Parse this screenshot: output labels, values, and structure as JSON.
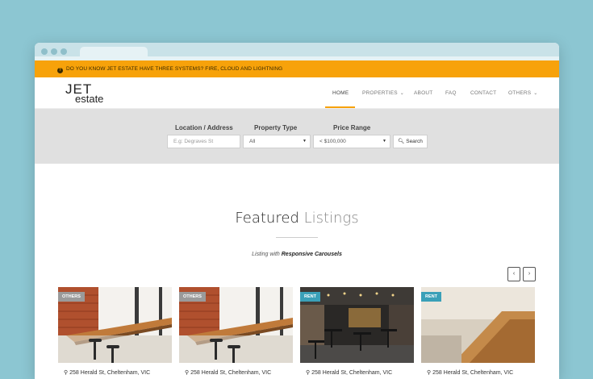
{
  "announcement": "DO YOU KNOW JET ESTATE HAVE THREE SYSTEMS? FIRE, CLOUD AND LIGHTNING",
  "logo": {
    "top": "JET",
    "bottom": "estate"
  },
  "nav": {
    "home": "HOME",
    "properties": "PROPERTIES",
    "about": "ABOUT",
    "faq": "FAQ",
    "contact": "CONTACT",
    "others": "OTHERS"
  },
  "search": {
    "location_label": "Location / Address",
    "location_placeholder": "E.g: Degraves St",
    "type_label": "Property Type",
    "type_value": "All",
    "price_label": "Price Range",
    "price_value": "< $100,000",
    "button_label": "Search"
  },
  "featured": {
    "title_bold": "Featured",
    "title_light": "Listings",
    "subtitle_prefix": "Listing with",
    "subtitle_emph": "Responsive Carousels"
  },
  "listings": [
    {
      "badge": "OTHERS",
      "address": "258 Herald St, Cheltenham, VIC"
    },
    {
      "badge": "OTHERS",
      "address": "258 Herald St, Cheltenham, VIC"
    },
    {
      "badge": "RENT",
      "address": "258 Herald St, Cheltenham, VIC"
    },
    {
      "badge": "RENT",
      "address": "258 Herald St, Cheltenham, VIC"
    }
  ],
  "colors": {
    "accent": "#f7a20a",
    "badge_others": "#9a9a9a",
    "badge_rent": "#3aa0b8",
    "background": "#8cc6d2"
  }
}
